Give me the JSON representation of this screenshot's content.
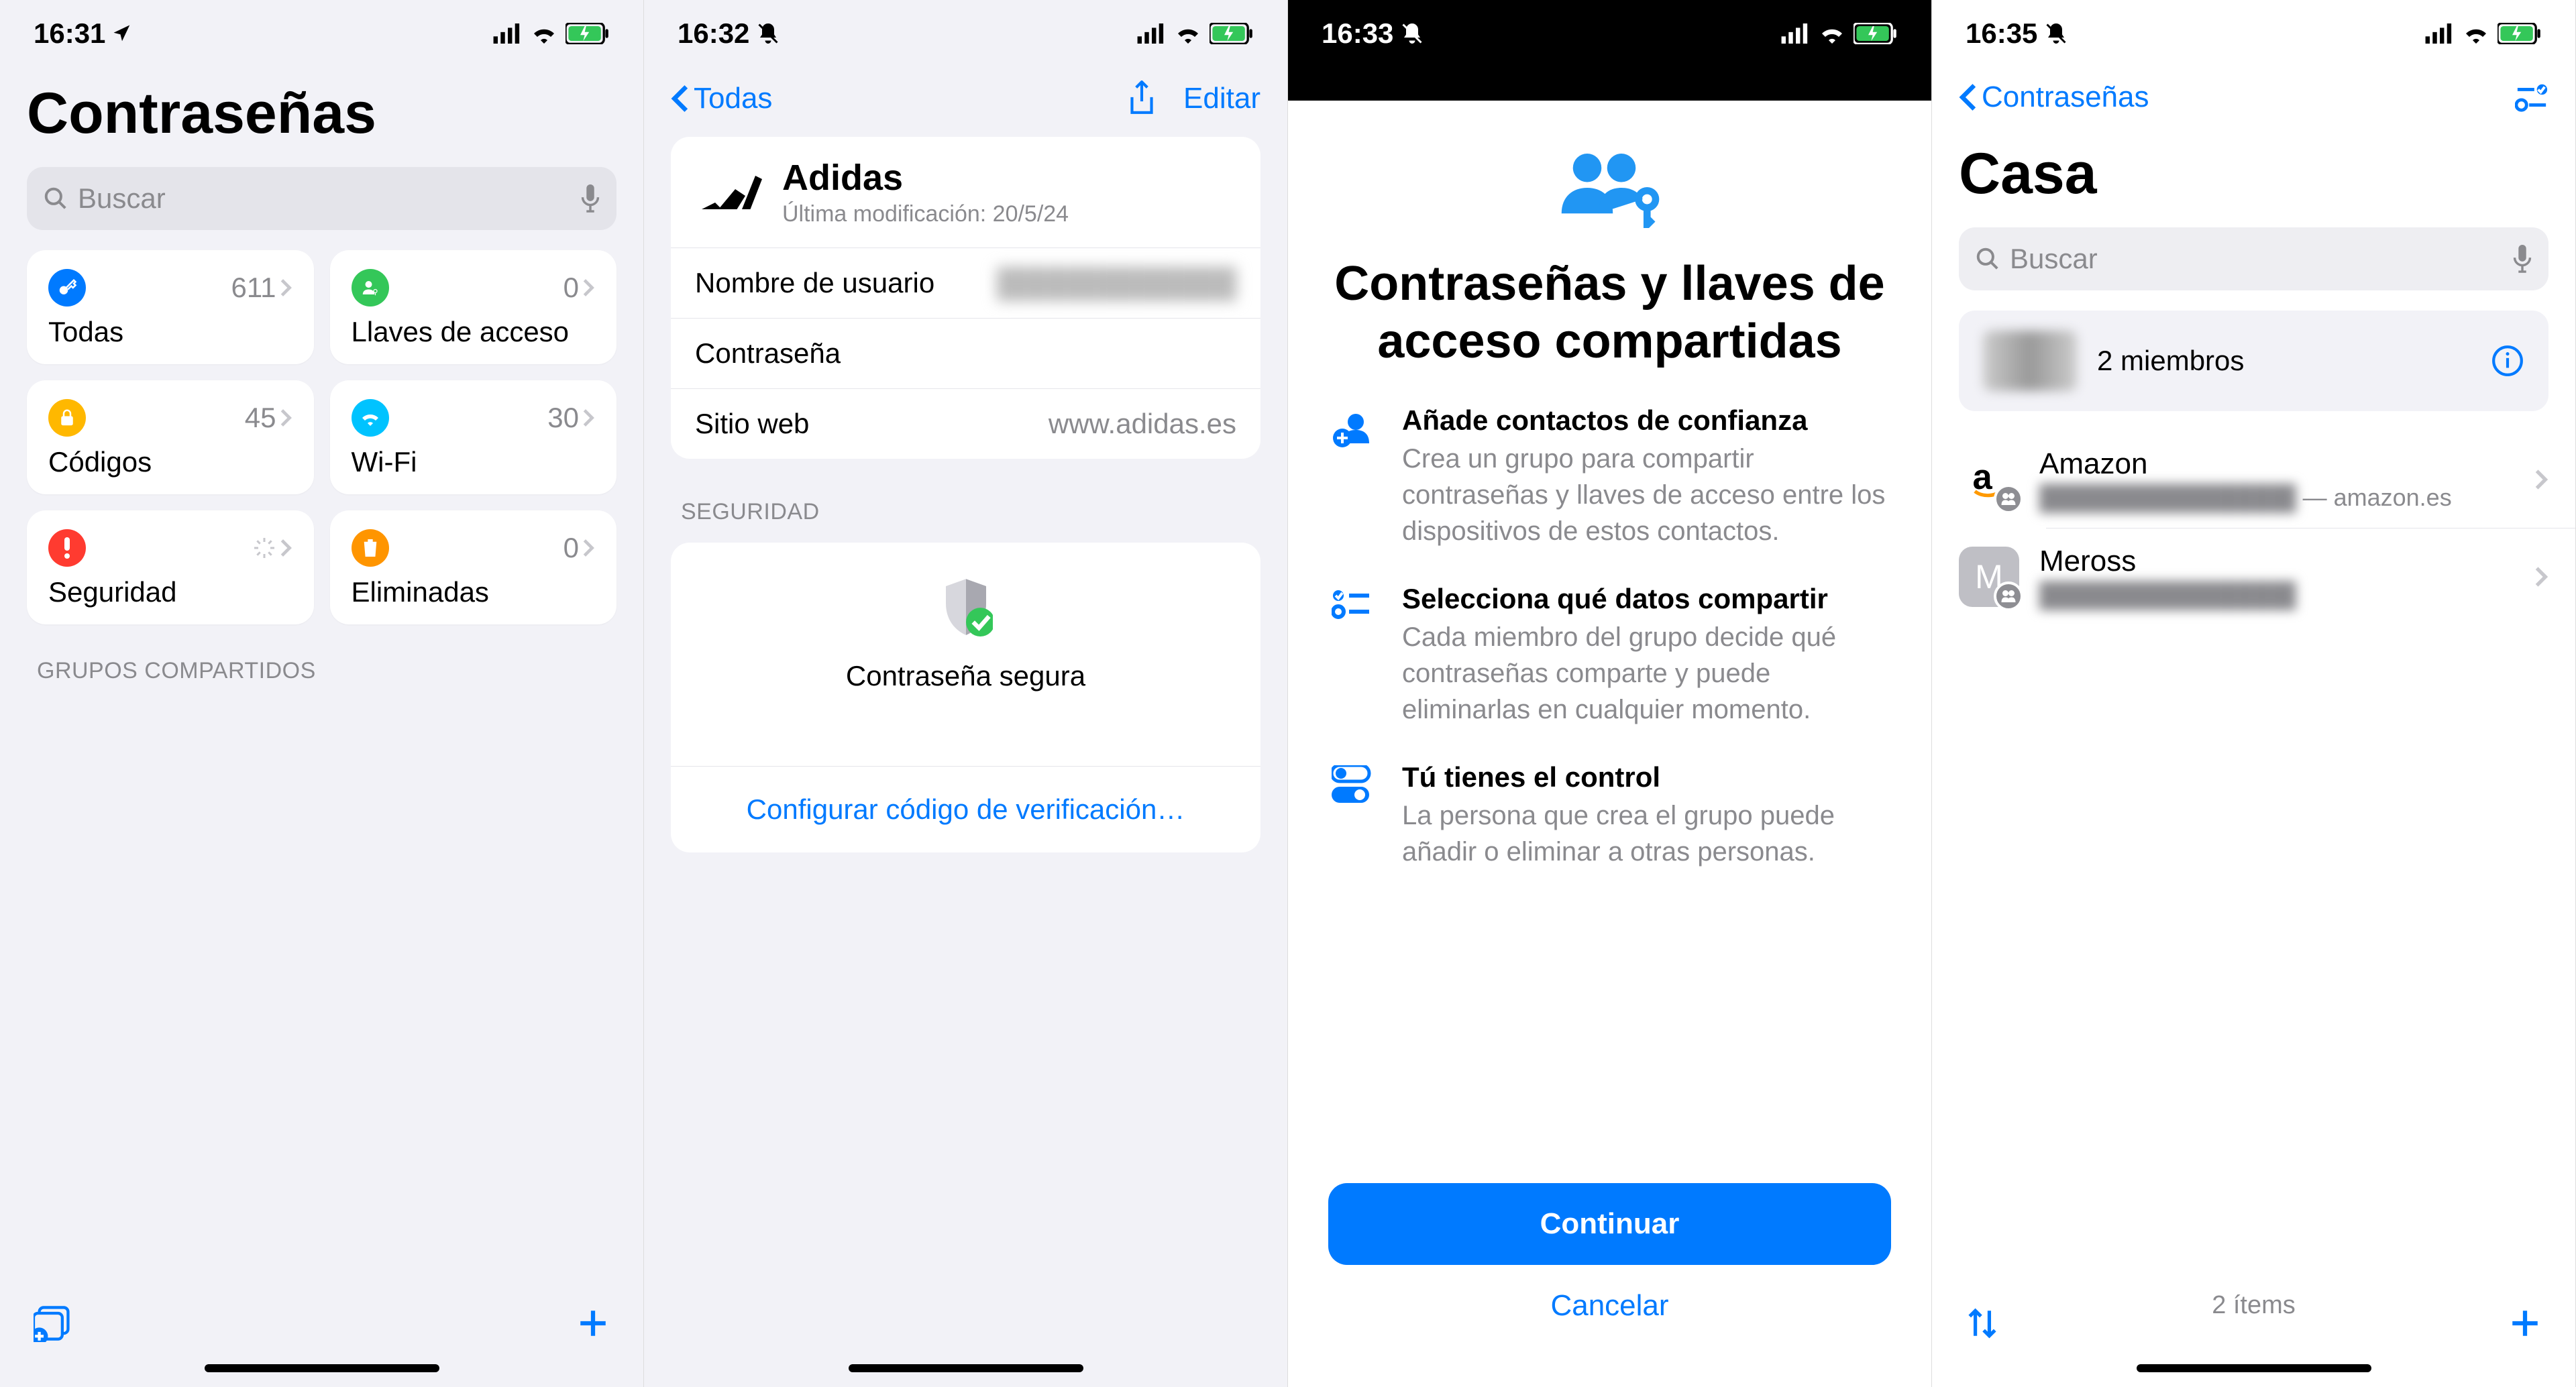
{
  "screen1": {
    "time": "16:31",
    "title": "Contraseñas",
    "search_placeholder": "Buscar",
    "tiles": {
      "all": {
        "label": "Todas",
        "count": "611"
      },
      "passkeys": {
        "label": "Llaves de acceso",
        "count": "0"
      },
      "codes": {
        "label": "Códigos",
        "count": "45"
      },
      "wifi": {
        "label": "Wi-Fi",
        "count": "30"
      },
      "security": {
        "label": "Seguridad",
        "count": ""
      },
      "deleted": {
        "label": "Eliminadas",
        "count": "0"
      }
    },
    "section_shared": "GRUPOS COMPARTIDOS"
  },
  "screen2": {
    "time": "16:32",
    "back": "Todas",
    "edit": "Editar",
    "entry": {
      "name": "Adidas",
      "modified": "Última modificación: 20/5/24",
      "username_label": "Nombre de usuario",
      "username_value": "████████████",
      "password_label": "Contraseña",
      "website_label": "Sitio web",
      "website_value": "www.adidas.es"
    },
    "security_header": "SEGURIDAD",
    "secure_text": "Contraseña segura",
    "setup_code": "Configurar código de verificación…"
  },
  "screen3": {
    "time": "16:33",
    "sheet_title": "Contraseñas y llaves de acceso compartidas",
    "items": [
      {
        "title": "Añade contactos de confianza",
        "desc": "Crea un grupo para compartir contraseñas y llaves de acceso entre los dispositivos de estos contactos."
      },
      {
        "title": "Selecciona qué datos compartir",
        "desc": "Cada miembro del grupo decide qué contraseñas comparte y puede eliminarlas en cualquier momento."
      },
      {
        "title": "Tú tienes el control",
        "desc": "La persona que crea el grupo puede añadir o eliminar a otras personas."
      }
    ],
    "continue": "Continuar",
    "cancel": "Cancelar"
  },
  "screen4": {
    "time": "16:35",
    "back": "Contraseñas",
    "title": "Casa",
    "search_placeholder": "Buscar",
    "members": "2 miembros",
    "items": [
      {
        "name": "Amazon",
        "detail": "███████████████",
        "suffix": " — amazon.es"
      },
      {
        "name": "Meross",
        "detail": "███████████████",
        "suffix": ""
      }
    ],
    "footer": "2 ítems"
  }
}
